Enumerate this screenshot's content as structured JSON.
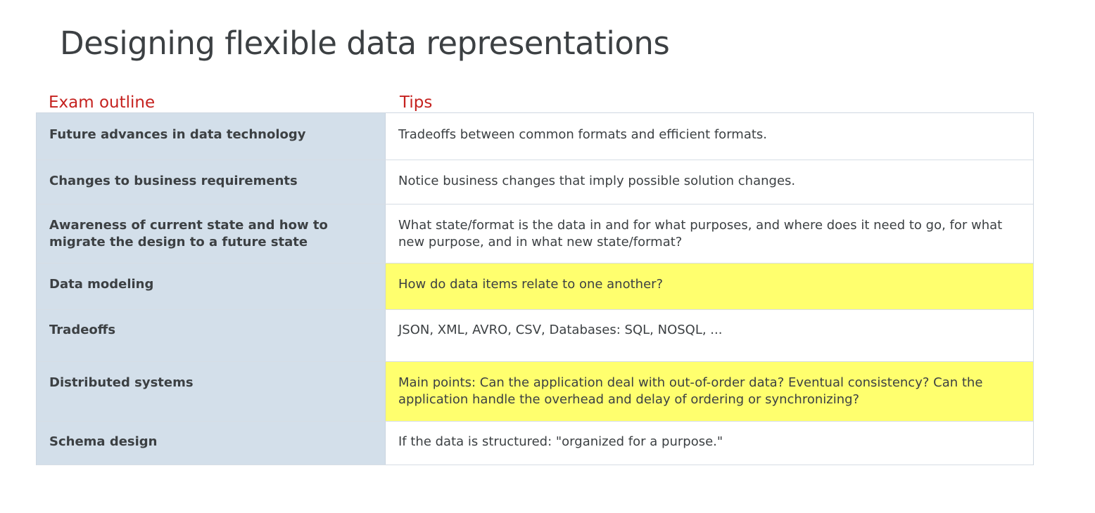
{
  "title": "Designing flexible data representations",
  "headers": {
    "outline": "Exam outline",
    "tips": "Tips"
  },
  "colors": {
    "title": "#3c4043",
    "heading_accent": "#c5221f",
    "outline_cell_bg": "#d3dfea",
    "highlight": "#ffff6e"
  },
  "rows": [
    {
      "outline": "Future advances in data technology",
      "tip": "Tradeoffs between common formats and efficient formats.",
      "highlighted": false
    },
    {
      "outline": "Changes to business requirements",
      "tip": "Notice business changes that imply possible solution changes.",
      "highlighted": false
    },
    {
      "outline": "Awareness of current state and how to migrate the design to a future state",
      "tip": "What state/format is the data in and for what purposes, and where does it need to go, for what new purpose, and in what new state/format?",
      "highlighted": false
    },
    {
      "outline": "Data modeling",
      "tip": "How do data items relate to one another?",
      "highlighted": true
    },
    {
      "outline": "Tradeoffs",
      "tip": "JSON, XML, AVRO, CSV, Databases: SQL, NOSQL, ...",
      "highlighted": false
    },
    {
      "outline": "Distributed systems",
      "tip": "Main points: Can the application deal with out-of-order data? Eventual consistency? Can the application handle the overhead and delay of ordering or synchronizing?",
      "highlighted": true
    },
    {
      "outline": "Schema design",
      "tip": "If the data is structured: \"organized for a purpose.\"",
      "highlighted": false
    }
  ]
}
